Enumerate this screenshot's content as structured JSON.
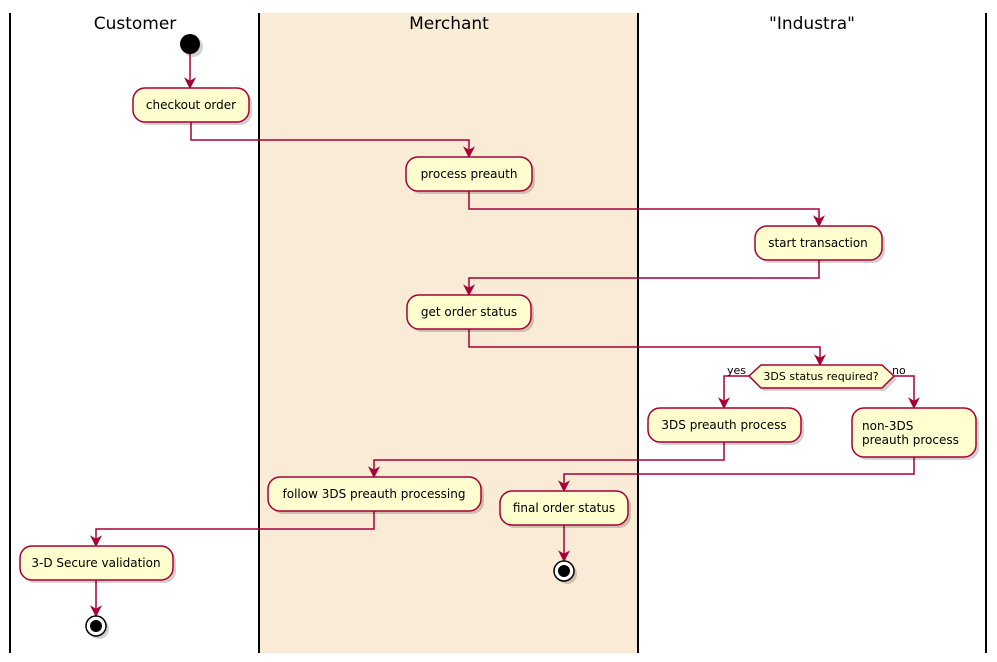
{
  "colors": {
    "merchant_lane": "#FAEBD7",
    "activity_fill": "#FEFECE",
    "activity_border": "#A80036",
    "arrow": "#A80036"
  },
  "lanes": [
    {
      "title": "Customer"
    },
    {
      "title": "Merchant"
    },
    {
      "title": "\"Industra\""
    }
  ],
  "activities": {
    "checkout_order": "checkout order",
    "process_preauth": "process preauth",
    "start_transaction": "start transaction",
    "get_order_status": "get order status",
    "preauth_3ds": "3DS preauth process",
    "non3ds_line1": "non-3DS",
    "non3ds_line2": "preauth process",
    "follow_3ds": "follow 3DS preauth processing",
    "final_order_status": "final order status",
    "secure_validation": "3-D Secure validation"
  },
  "decision": {
    "label": "3DS status required?",
    "yes": "yes",
    "no": "no"
  }
}
